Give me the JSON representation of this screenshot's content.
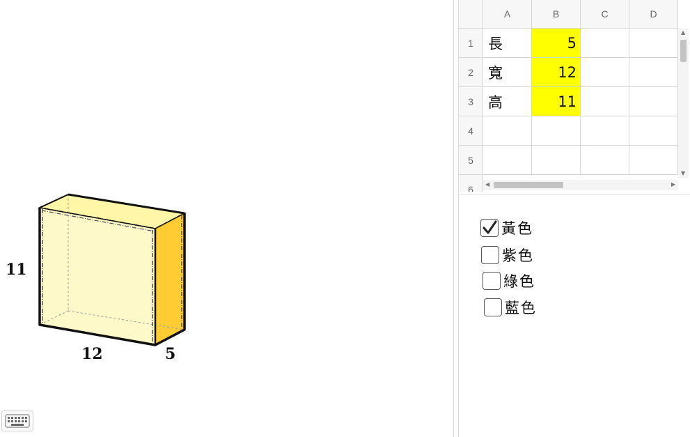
{
  "graphics": {
    "dims": {
      "height": "11",
      "length": "12",
      "width": "5"
    },
    "box_colors": {
      "front": "#fef9c9",
      "top": "#fff6a8",
      "side": "#ffcc33",
      "edge": "#111111"
    }
  },
  "spreadsheet": {
    "columns": [
      "A",
      "B",
      "C",
      "D"
    ],
    "rows": [
      "1",
      "2",
      "3",
      "4",
      "5",
      "6"
    ],
    "cells": [
      {
        "label": "長",
        "value": "5"
      },
      {
        "label": "寬",
        "value": "12"
      },
      {
        "label": "高",
        "value": "11"
      }
    ],
    "highlight_color": "#ffff00"
  },
  "checkboxes": [
    {
      "label": "黃色",
      "checked": true
    },
    {
      "label": "紫色",
      "checked": false
    },
    {
      "label": "綠色",
      "checked": false
    },
    {
      "label": "藍色",
      "checked": false
    }
  ],
  "icons": {
    "keyboard": "keyboard-icon",
    "check": "check-icon"
  }
}
